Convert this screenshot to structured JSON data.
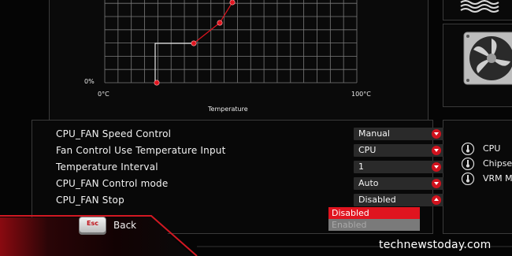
{
  "graph": {
    "y_tick_low": "0%",
    "x_tick_low": "0°C",
    "x_tick_high": "100°C",
    "x_axis_label": "Temperature",
    "curve_color": "#e0141f"
  },
  "settings": [
    {
      "label": "CPU_FAN Speed Control",
      "value": "Manual"
    },
    {
      "label": "Fan Control Use Temperature Input",
      "value": "CPU"
    },
    {
      "label": "Temperature Interval",
      "value": "1"
    },
    {
      "label": "CPU_FAN Control mode",
      "value": "Auto"
    },
    {
      "label": "CPU_FAN Stop",
      "value": "Disabled"
    }
  ],
  "dropdown": {
    "options": [
      "Disabled",
      "Enabled"
    ],
    "selected": "Disabled"
  },
  "temperatures": {
    "items": [
      {
        "label": "CPU",
        "icon": "thermometer-icon"
      },
      {
        "label": "Chipse",
        "icon": "thermometer-icon"
      },
      {
        "label": "VRM M",
        "icon": "thermometer-icon"
      }
    ]
  },
  "footer": {
    "esc_key": "Esc",
    "back_label": "Back",
    "watermark": "technewstoday.com"
  },
  "theme": {
    "accent": "#e0141f",
    "background": "#050505"
  }
}
